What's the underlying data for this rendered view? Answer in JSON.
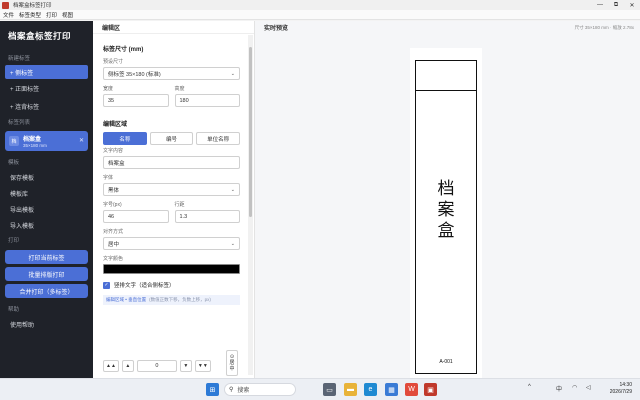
{
  "window": {
    "title": "档案盒标签打印",
    "minimize": "—",
    "maximize": "⧉",
    "close": "✕"
  },
  "menubar": [
    "文件",
    "标签类型",
    "打印",
    "视图"
  ],
  "sidebar": {
    "brand": "档案盒标签打印",
    "section_new": "新建标签",
    "new_items": [
      "+ 侧标签",
      "+ 正面标签",
      "+ 连背标签"
    ],
    "section_list": "标签列表",
    "template": {
      "icon": "档",
      "name": "档案盒",
      "size": "35×180 mm",
      "close": "✕"
    },
    "section_template": "模板",
    "template_actions": [
      "保存模板",
      "模板库",
      "导出模板",
      "导入模板"
    ],
    "section_print": "打印",
    "print_actions": [
      "打印当前标签",
      "批量排版打印",
      "合并打印（多标签）"
    ],
    "section_help": "帮助",
    "help_item": "使用帮助"
  },
  "editor": {
    "header": "编辑区",
    "size_title": "标签尺寸 (mm)",
    "preset_label": "预设尺寸",
    "preset_value": "侧标签 35×180 (标准)",
    "width_label": "宽度",
    "width_value": "35",
    "height_label": "高度",
    "height_value": "180",
    "area_title": "编辑区域",
    "tabs": [
      "名称",
      "编号",
      "单位名称"
    ],
    "text_label": "文字内容",
    "text_value": "档案盒",
    "font_label": "字体",
    "font_value": "黑体",
    "size_label": "字号(px)",
    "size_value": "46",
    "line_label": "行距",
    "line_value": "1.3",
    "align_label": "对齐方式",
    "align_value": "居中",
    "color_label": "文字颜色",
    "vertical_check": "竖排文字（适合侧标签）",
    "info_main": "编辑区域 • 垂直位置",
    "info_hint": "(数值正数下移，负数上移，px)",
    "pos_up2": "▲▲",
    "pos_up": "▲",
    "pos_value": "0",
    "pos_down": "▼",
    "pos_down2": "▼▼",
    "center_icon": "⊙",
    "center_label_1": "居",
    "center_label_2": "中"
  },
  "preview": {
    "header": "实时预览",
    "size_info": "尺寸 35×180 mm · 缩放 2.78x",
    "label_text": "档案盒",
    "label_code": "A-001"
  },
  "taskbar": {
    "search_placeholder": "搜索",
    "tray_chevron": "^",
    "tray_lang": "中",
    "tray_wifi": "◠",
    "tray_sound": "◁",
    "time": "14:30",
    "date": "2026/7/29"
  },
  "colors": {
    "sidebar_bg": "#1f2229",
    "accent": "#4b6fd6",
    "preview_bg": "#f5f6f8"
  }
}
